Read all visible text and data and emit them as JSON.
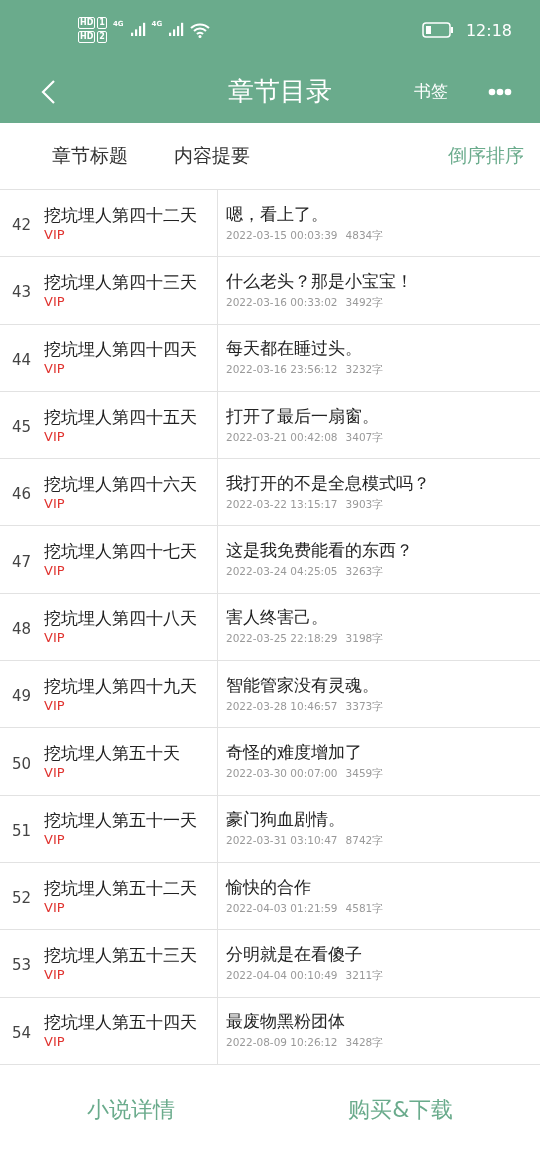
{
  "status_bar": {
    "hd_badges": [
      {
        "label": "HD",
        "sim": "1"
      },
      {
        "label": "HD",
        "sim": "2"
      }
    ],
    "networks": [
      "4G",
      "4G"
    ],
    "time": "12:18"
  },
  "toolbar": {
    "title": "章节目录",
    "bookmark": "书签"
  },
  "header": {
    "columns": [
      "章节标题",
      "内容提要"
    ],
    "sort": "倒序排序"
  },
  "chapters": [
    {
      "number": "42",
      "title": "挖坑埋人第四十二天",
      "badge": "VIP",
      "summary": "嗯，看上了。",
      "date": "2022-03-15 00:03:39",
      "words": "4834字"
    },
    {
      "number": "43",
      "title": "挖坑埋人第四十三天",
      "badge": "VIP",
      "summary": "什么老头？那是小宝宝！",
      "date": "2022-03-16 00:33:02",
      "words": "3492字"
    },
    {
      "number": "44",
      "title": "挖坑埋人第四十四天",
      "badge": "VIP",
      "summary": "每天都在睡过头。",
      "date": "2022-03-16 23:56:12",
      "words": "3232字"
    },
    {
      "number": "45",
      "title": "挖坑埋人第四十五天",
      "badge": "VIP",
      "summary": "打开了最后一扇窗。",
      "date": "2022-03-21 00:42:08",
      "words": "3407字"
    },
    {
      "number": "46",
      "title": "挖坑埋人第四十六天",
      "badge": "VIP",
      "summary": "我打开的不是全息模式吗？",
      "date": "2022-03-22 13:15:17",
      "words": "3903字"
    },
    {
      "number": "47",
      "title": "挖坑埋人第四十七天",
      "badge": "VIP",
      "summary": "这是我免费能看的东西？",
      "date": "2022-03-24 04:25:05",
      "words": "3263字"
    },
    {
      "number": "48",
      "title": "挖坑埋人第四十八天",
      "badge": "VIP",
      "summary": "害人终害己。",
      "date": "2022-03-25 22:18:29",
      "words": "3198字"
    },
    {
      "number": "49",
      "title": "挖坑埋人第四十九天",
      "badge": "VIP",
      "summary": "智能管家没有灵魂。",
      "date": "2022-03-28 10:46:57",
      "words": "3373字"
    },
    {
      "number": "50",
      "title": "挖坑埋人第五十天",
      "badge": "VIP",
      "summary": "奇怪的难度增加了",
      "date": "2022-03-30 00:07:00",
      "words": "3459字"
    },
    {
      "number": "51",
      "title": "挖坑埋人第五十一天",
      "badge": "VIP",
      "summary": "豪门狗血剧情。",
      "date": "2022-03-31 03:10:47",
      "words": "8742字"
    },
    {
      "number": "52",
      "title": "挖坑埋人第五十二天",
      "badge": "VIP",
      "summary": "愉快的合作",
      "date": "2022-04-03 01:21:59",
      "words": "4581字"
    },
    {
      "number": "53",
      "title": "挖坑埋人第五十三天",
      "badge": "VIP",
      "summary": "分明就是在看傻子",
      "date": "2022-04-04 00:10:49",
      "words": "3211字"
    },
    {
      "number": "54",
      "title": "挖坑埋人第五十四天",
      "badge": "VIP",
      "summary": "最废物黑粉团体",
      "date": "2022-08-09 10:26:12",
      "words": "3428字"
    }
  ],
  "footer": {
    "buttons": [
      "小说详情",
      "购买&下载"
    ]
  }
}
